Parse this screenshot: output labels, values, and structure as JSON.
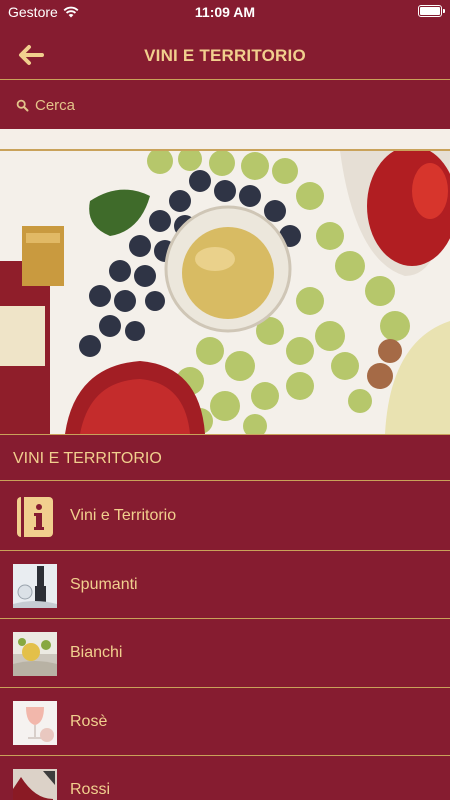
{
  "status_bar": {
    "carrier": "Gestore",
    "time": "11:09 AM"
  },
  "nav": {
    "title": "VINI E TERRITORIO",
    "back_icon": "arrow-left-icon"
  },
  "search": {
    "placeholder": "Cerca",
    "value": ""
  },
  "section": {
    "title": "VINI E TERRITORIO"
  },
  "menu": {
    "items": [
      {
        "label": "Vini e Territorio",
        "icon": "info-book-icon"
      },
      {
        "label": "Spumanti",
        "icon": "spumanti-thumbnail"
      },
      {
        "label": "Bianchi",
        "icon": "bianchi-thumbnail"
      },
      {
        "label": "Rosè",
        "icon": "rose-thumbnail"
      },
      {
        "label": "Rossi",
        "icon": "rossi-thumbnail"
      }
    ]
  },
  "colors": {
    "background": "#861c30",
    "accent_text": "#f1cf8e",
    "divider": "#c9a25a"
  }
}
